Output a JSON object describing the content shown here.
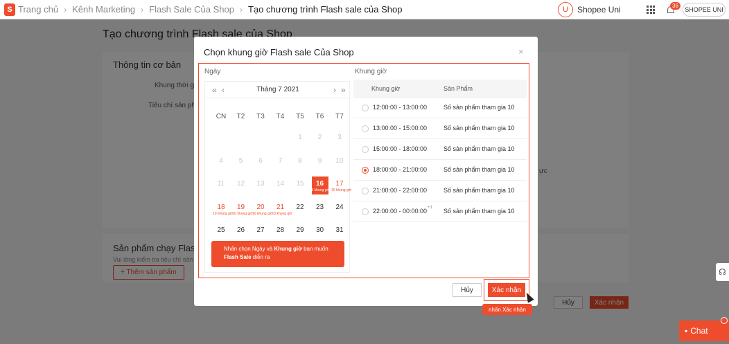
{
  "breadcrumb": [
    "Trang chủ",
    "Kênh Marketing",
    "Flash Sale Của Shop",
    "Tạo chương trình Flash sale của Shop"
  ],
  "header": {
    "logo_text": "S",
    "uni_badge": "U",
    "uni_label": "Shopee Uni",
    "notif_count": "36",
    "account": "SHOPEE UNI"
  },
  "background": {
    "title": "Tạo chương trình Flash sale của Shop",
    "basic_info_title": "Thông tin cơ bản",
    "time_label": "Khung thời gian",
    "criteria_label": "Tiêu chí sản phẩm",
    "side_text": "ực",
    "products_title": "Sản phẩm chạy Flash Sale",
    "products_sub": "Vui lòng kiểm tra tiêu chí sản phẩm",
    "add_product": "+ Thêm sản phẩm",
    "cancel": "Hủy",
    "confirm": "Xác nhận",
    "chat": "Chat"
  },
  "modal": {
    "title": "Chọn khung giờ Flash sale Của Shop",
    "close": "×",
    "day_label": "Ngày",
    "slot_label": "Khung giờ",
    "cancel": "Hủy",
    "confirm": "Xác nhận",
    "callout": "nhấn Xác nhận"
  },
  "calendar": {
    "month": "Tháng 7 2021",
    "nav_prev_year": "«",
    "nav_prev": "‹",
    "nav_next": "›",
    "nav_next_year": "»",
    "weekdays": [
      "CN",
      "T2",
      "T3",
      "T4",
      "T5",
      "T6",
      "T7"
    ],
    "rows": [
      [
        {
          "d": "",
          "s": "muted"
        },
        {
          "d": "",
          "s": "muted"
        },
        {
          "d": "",
          "s": "muted"
        },
        {
          "d": "",
          "s": "muted"
        },
        {
          "d": "1",
          "s": "muted"
        },
        {
          "d": "2",
          "s": "muted"
        },
        {
          "d": "3",
          "s": "muted"
        }
      ],
      [
        {
          "d": "4",
          "s": "muted"
        },
        {
          "d": "5",
          "s": "muted"
        },
        {
          "d": "6",
          "s": "muted"
        },
        {
          "d": "7",
          "s": "muted"
        },
        {
          "d": "8",
          "s": "muted"
        },
        {
          "d": "9",
          "s": "muted"
        },
        {
          "d": "10",
          "s": "muted"
        }
      ],
      [
        {
          "d": "11",
          "s": "muted"
        },
        {
          "d": "12",
          "s": "muted"
        },
        {
          "d": "13",
          "s": "muted"
        },
        {
          "d": "14",
          "s": "muted"
        },
        {
          "d": "15",
          "s": "muted"
        },
        {
          "d": "16",
          "s": "sel",
          "note": "6 khung giờ"
        },
        {
          "d": "17",
          "s": "avail",
          "note": "10 khung giờ"
        }
      ],
      [
        {
          "d": "18",
          "s": "avail",
          "note": "10 khung giờ"
        },
        {
          "d": "19",
          "s": "avail",
          "note": "10 khung giờ"
        },
        {
          "d": "20",
          "s": "avail",
          "note": "10 khung giờ"
        },
        {
          "d": "21",
          "s": "avail",
          "note": "10 khung giờ"
        },
        {
          "d": "22",
          "s": "normal"
        },
        {
          "d": "23",
          "s": "normal"
        },
        {
          "d": "24",
          "s": "normal"
        }
      ],
      [
        {
          "d": "25",
          "s": "normal"
        },
        {
          "d": "26",
          "s": "normal"
        },
        {
          "d": "27",
          "s": "normal"
        },
        {
          "d": "28",
          "s": "normal"
        },
        {
          "d": "29",
          "s": "normal"
        },
        {
          "d": "30",
          "s": "normal"
        },
        {
          "d": "31",
          "s": "normal"
        }
      ]
    ],
    "tip_pre": "Nhấn chọn Ngày và ",
    "tip_bold1": "Khung giờ",
    "tip_mid": " bạn muốn",
    "tip_bold2": "Flash Sale",
    "tip_post": " diễn ra"
  },
  "slots": {
    "col_time": "Khung giờ",
    "col_product": "Sản Phẩm",
    "rows": [
      {
        "time": "12:00:00 - 13:00:00",
        "product": "Số sản phẩm tham gia 10",
        "selected": false
      },
      {
        "time": "13:00:00 - 15:00:00",
        "product": "Số sản phẩm tham gia 10",
        "selected": false
      },
      {
        "time": "15:00:00 - 18:00:00",
        "product": "Số sản phẩm tham gia 10",
        "selected": false
      },
      {
        "time": "18:00:00 - 21:00:00",
        "product": "Số sản phẩm tham gia 10",
        "selected": true
      },
      {
        "time": "21:00:00 - 22:00:00",
        "product": "Số sản phẩm tham gia 10",
        "selected": false
      },
      {
        "time": "22:00:00 - 00:00:00",
        "plus": "+1",
        "product": "Số sản phẩm tham gia 10",
        "selected": false
      }
    ]
  },
  "colors": {
    "accent": "#ee4d2d"
  }
}
